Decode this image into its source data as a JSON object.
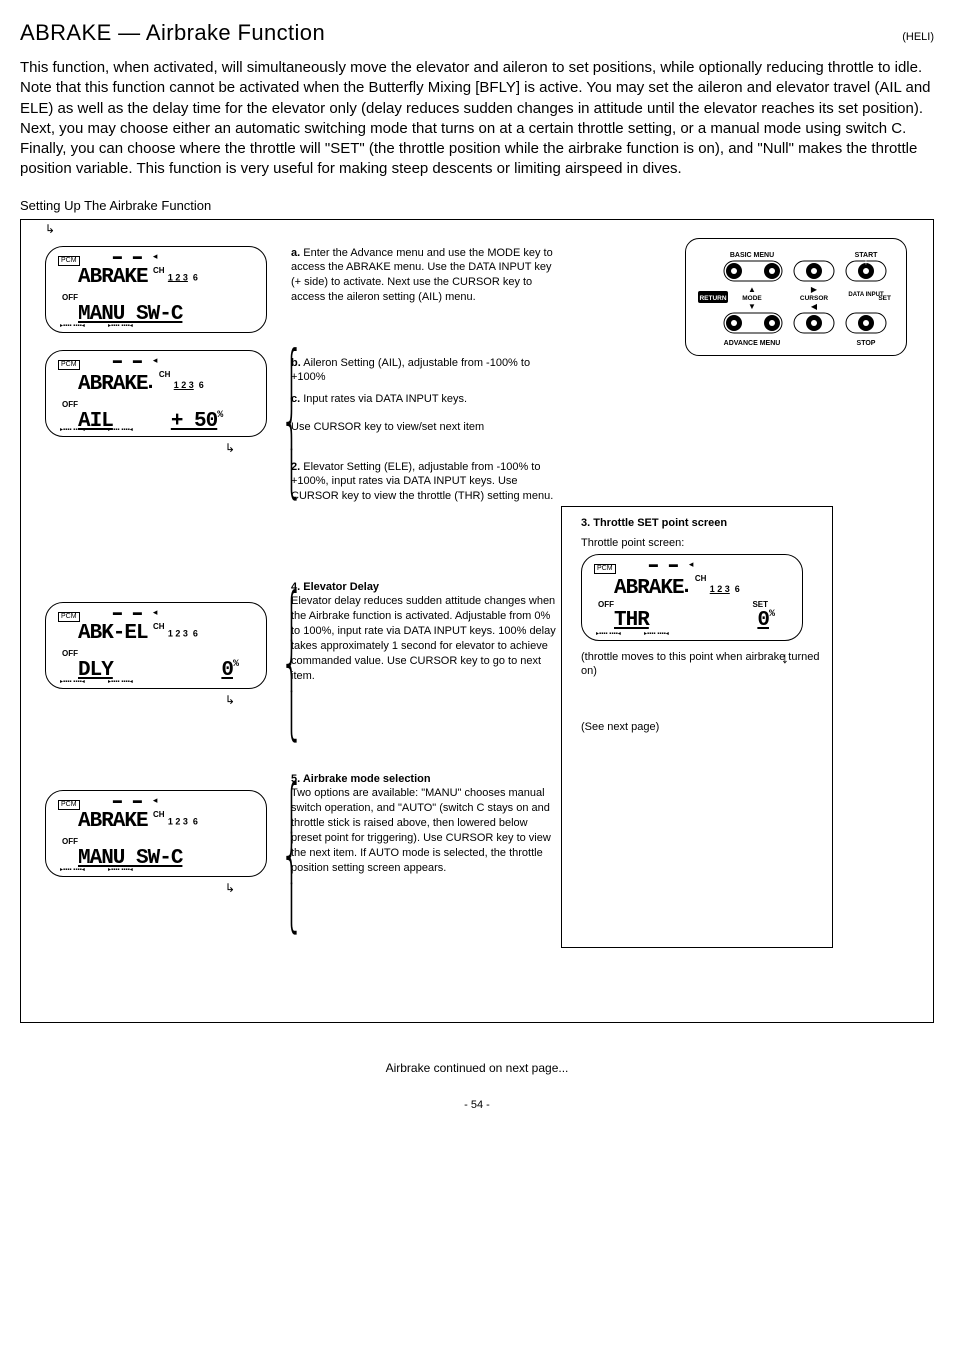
{
  "header": {
    "title": "ABRAKE — Airbrake Function",
    "right": "(HELI)"
  },
  "description": "This function, when activated, will simultaneously move the elevator and aileron to set positions, while optionally reducing throttle to idle. Note that this function cannot be activated when the Butterfly Mixing [BFLY] is active. You may set the aileron and elevator travel (AIL and ELE) as well as the delay time for the elevator only (delay reduces sudden changes in attitude until the elevator reaches its set position). Next, you may choose either an automatic switching mode that turns on at a certain throttle setting, or a manual mode using switch C. Finally, you can choose where the throttle will \"SET\" (the throttle position while the airbrake function is on), and \"Null\" makes the throttle position variable. This function is very useful for making steep descents or limiting airspeed in dives.",
  "setting_title": "Setting Up The Airbrake Function",
  "notes": {
    "a": "Enter the Advance menu and use the MODE key to access the ABRAKE menu. Use the DATA INPUT key (+ side) to activate. Next use the CURSOR key to access the aileron setting (AIL) menu.",
    "b": "Aileron Setting (AIL), adjustable from -100% to +100%",
    "c": "Input rates via DATA INPUT keys.",
    "cursor_note": "Use CURSOR key to view/set next item",
    "elev_text": "Elevator Setting (ELE), adjustable from -100% to +100%, input rates via DATA INPUT keys. Use CURSOR key to view the throttle (THR) setting menu.",
    "step3_head": "3. Throttle SET point screen",
    "step3_sub": "Throttle point screen:",
    "step3_body": "(throttle moves to this point when airbrake turned on)",
    "download": "(See next page)",
    "delay_head": "4. Elevator Delay",
    "delay_body": "Elevator delay reduces sudden attitude changes when the Airbrake function is activated. Adjustable from 0% to 100%, input rate via DATA INPUT keys. 100% delay takes approximately 1 second for elevator to achieve commanded value. Use CURSOR key to go to next item.",
    "mode_head": "5. Airbrake mode selection",
    "mode_body": "Two options are available: \"MANU\" chooses manual switch operation, and \"AUTO\" (switch C stays on and throttle stick is raised above, then lowered below preset point for triggering). Use CURSOR key to view the next item. If AUTO mode is selected, the throttle position setting screen appears."
  },
  "lcd": {
    "pcm": "PCM",
    "func": "ABRAKE",
    "abkel": "ABK-EL",
    "ch": "CH",
    "chn": "1 2 3",
    "ch6": "6",
    "off": "OFF",
    "manu": "MANU SW-C",
    "ail": "AIL",
    "ail_val": "+ 50",
    "dly": "DLY",
    "dly_val": "0",
    "thr": "THR",
    "thr_val": "0",
    "set": "SET",
    "pct": "%"
  },
  "keypad": {
    "basic": "BASIC MENU",
    "start": "START",
    "return": "RETURN",
    "mode": "MODE",
    "cursor": "CURSOR",
    "data": "DATA INPUT",
    "set": "SET",
    "advance": "ADVANCE MENU",
    "stop": "STOP"
  },
  "bottom_link": "Airbrake continued on next page...",
  "footer": "- 54 -"
}
